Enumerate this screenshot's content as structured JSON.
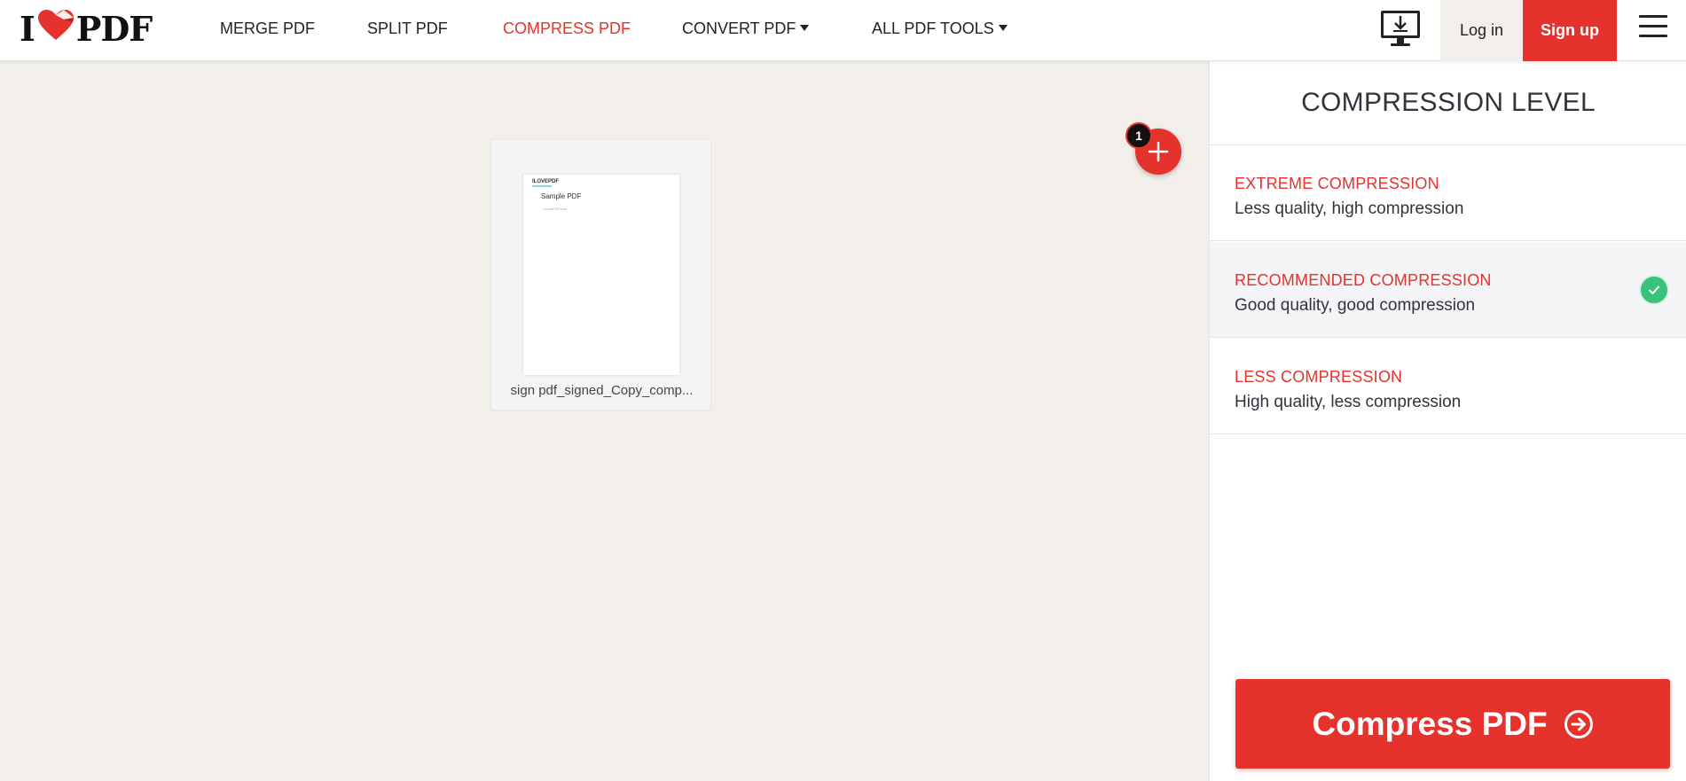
{
  "header": {
    "logo": {
      "prefix": "I",
      "suffix": "PDF"
    },
    "nav": [
      {
        "label": "MERGE PDF"
      },
      {
        "label": "SPLIT PDF"
      },
      {
        "label": "COMPRESS PDF",
        "active": true
      },
      {
        "label": "CONVERT PDF",
        "dropdown": true
      },
      {
        "label": "ALL PDF TOOLS",
        "dropdown": true
      }
    ],
    "desktop_icon": "desktop-download-icon",
    "login_label": "Log in",
    "signup_label": "Sign up",
    "menu_icon": "hamburger-menu-icon"
  },
  "workspace": {
    "file": {
      "name": "sign pdf_signed_Copy_comp...",
      "thumb_logo": "ILOVEPDF",
      "thumb_title": "Sample PDF",
      "thumb_line": "~ iLovePDF.com"
    },
    "file_count_badge": "1",
    "add_icon": "plus-icon"
  },
  "sidebar": {
    "title": "COMPRESSION LEVEL",
    "options": [
      {
        "title": "EXTREME COMPRESSION",
        "desc": "Less quality, high compression",
        "selected": false
      },
      {
        "title": "RECOMMENDED COMPRESSION",
        "desc": "Good quality, good compression",
        "selected": true
      },
      {
        "title": "LESS COMPRESSION",
        "desc": "High quality, less compression",
        "selected": false
      }
    ],
    "compress_label": "Compress PDF",
    "compress_icon": "arrow-right-circle-icon"
  },
  "colors": {
    "brand_red": "#e5322d",
    "workspace_bg": "#f2efea",
    "check_green": "#3ac17a"
  }
}
